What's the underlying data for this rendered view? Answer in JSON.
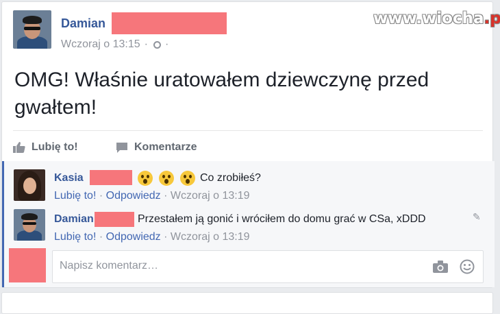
{
  "post": {
    "author": "Damian",
    "time": "Wczoraj o 13:15",
    "separator": "·",
    "text": "OMG! Właśnie uratowałem dziewczynę przed gwałtem!"
  },
  "actions": {
    "like": "Lubię to!",
    "comment": "Komentarze"
  },
  "comments": [
    {
      "author": "Kasia",
      "emojis": [
        "surprised-face",
        "surprised-face",
        "surprised-face"
      ],
      "text": "Co zrobiłeś?",
      "like": "Lubię to!",
      "reply": "Odpowiedz",
      "time": "Wczoraj o 13:19"
    },
    {
      "author": "Damian",
      "text": "Przestałem ją gonić i wróciłem do domu grać w CSa, xDDD",
      "like": "Lubię to!",
      "reply": "Odpowiedz",
      "time": "Wczoraj o 13:19"
    }
  ],
  "compose": {
    "placeholder": "Napisz komentarz…"
  },
  "watermark": {
    "text": "www.wiocha",
    "suffix": ".pl"
  },
  "colors": {
    "link": "#365899",
    "redaction": "#f6767b",
    "thread_accent": "#4267b2"
  }
}
